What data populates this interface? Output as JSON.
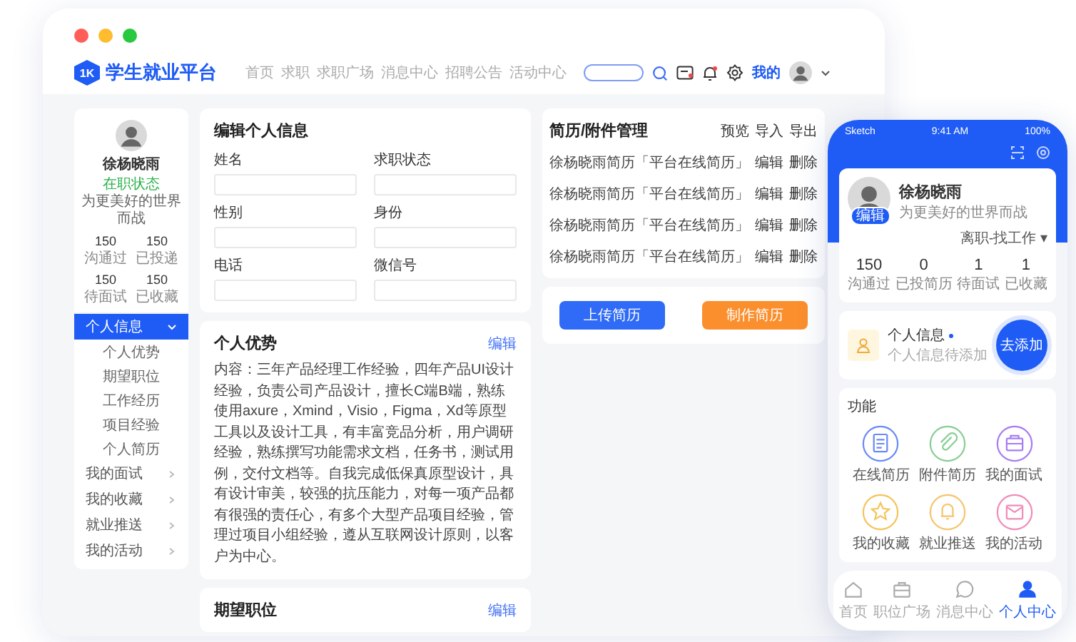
{
  "header": {
    "logo_mark": "1K",
    "title": "学生就业平台",
    "nav": [
      {
        "label": "首页",
        "selected": false
      },
      {
        "label": "求职",
        "selected": false
      },
      {
        "label": "求职广场",
        "selected": false
      },
      {
        "label": "消息中心",
        "selected": false
      },
      {
        "label": "招聘公告",
        "selected": false
      },
      {
        "label": "活动中心",
        "selected": false
      }
    ],
    "user_label": "我的"
  },
  "sidebar": {
    "name": "徐杨晓雨",
    "status": "在职状态",
    "motto": "为更美好的世界而战",
    "stats": [
      {
        "value": "150",
        "label": "沟通过"
      },
      {
        "value": "150",
        "label": "已投递"
      },
      {
        "value": "150",
        "label": "待面试"
      },
      {
        "value": "150",
        "label": "已收藏"
      }
    ],
    "menu": [
      {
        "label": "个人信息",
        "selected": true,
        "expanded": true,
        "children": [
          {
            "label": "个人优势",
            "selected": false
          },
          {
            "label": "期望职位",
            "selected": false
          },
          {
            "label": "工作经历",
            "selected": false
          },
          {
            "label": "项目经验",
            "selected": false
          },
          {
            "label": "个人简历",
            "selected": false
          }
        ]
      },
      {
        "label": "我的面试",
        "selected": false,
        "expanded": false
      },
      {
        "label": "我的收藏",
        "selected": false,
        "expanded": false
      },
      {
        "label": "就业推送",
        "selected": false,
        "expanded": false
      },
      {
        "label": "我的活动",
        "selected": false,
        "expanded": false
      }
    ]
  },
  "edit_info": {
    "title": "编辑个人信息",
    "fields": [
      {
        "label": "姓名"
      },
      {
        "label": "求职状态"
      },
      {
        "label": "性别"
      },
      {
        "label": "身份"
      },
      {
        "label": "电话"
      },
      {
        "label": "微信号"
      }
    ]
  },
  "advantages": {
    "title": "个人优势",
    "action": "编辑",
    "content": "内容：三年产品经理工作经验，四年产品UI设计经验，负责公司产品设计，擅长C端B端，熟练使用axure，Xmind，Visio，Figma，Xd等原型工具以及设计工具，有丰富竞品分析，用户调研经验，熟练撰写功能需求文档，任务书，测试用例，交付文档等。自我完成低保真原型设计，具有设计审美，较强的抗压能力，对每一项产品都有很强的责任心，有多个大型产品项目经验，管理过项目小组经验，遵从互联网设计原则，以客户为中心。"
  },
  "expected_position": {
    "title": "期望职位",
    "action": "编辑"
  },
  "resumes": {
    "title": "简历/附件管理",
    "actions": [
      "预览",
      "导入",
      "导出"
    ],
    "items": [
      {
        "name": "徐杨晓雨简历「平台在线简历」",
        "actions": [
          "编辑",
          "删除"
        ]
      },
      {
        "name": "徐杨晓雨简历「平台在线简历」",
        "actions": [
          "编辑",
          "删除"
        ]
      },
      {
        "name": "徐杨晓雨简历「平台在线简历」",
        "actions": [
          "编辑",
          "删除"
        ]
      },
      {
        "name": "徐杨晓雨简历「平台在线简历」",
        "actions": [
          "编辑",
          "删除"
        ]
      }
    ],
    "buttons": [
      {
        "label": "上传简历",
        "kind": "primary"
      },
      {
        "label": "制作简历",
        "kind": "secondary"
      }
    ]
  },
  "phone": {
    "status_bar": {
      "carrier": "Sketch",
      "time": "9:41 AM",
      "battery": "100%"
    },
    "profile": {
      "badge": "编辑",
      "name": "徐杨晓雨",
      "motto": "为更美好的世界而战",
      "job_status": "离职-找工作 ▾"
    },
    "stats": [
      {
        "value": "150",
        "label": "沟通过"
      },
      {
        "value": "0",
        "label": "已投简历"
      },
      {
        "value": "1",
        "label": "待面试"
      },
      {
        "value": "1",
        "label": "已收藏"
      }
    ],
    "info_card": {
      "title": "个人信息",
      "subtitle": "个人信息待添加",
      "button": "去添加"
    },
    "functions": {
      "title": "功能",
      "items": [
        {
          "label": "在线简历",
          "color": "#6b8af5"
        },
        {
          "label": "附件简历",
          "color": "#86cf94"
        },
        {
          "label": "我的面试",
          "color": "#a77cf2"
        },
        {
          "label": "我的收藏",
          "color": "#f4c45a"
        },
        {
          "label": "就业推送",
          "color": "#f6c46e"
        },
        {
          "label": "我的活动",
          "color": "#f08cb8"
        }
      ]
    },
    "tab_bar": [
      {
        "label": "首页",
        "selected": false
      },
      {
        "label": "职位广场",
        "selected": false
      },
      {
        "label": "消息中心",
        "selected": false
      },
      {
        "label": "个人中心",
        "selected": true
      }
    ]
  }
}
